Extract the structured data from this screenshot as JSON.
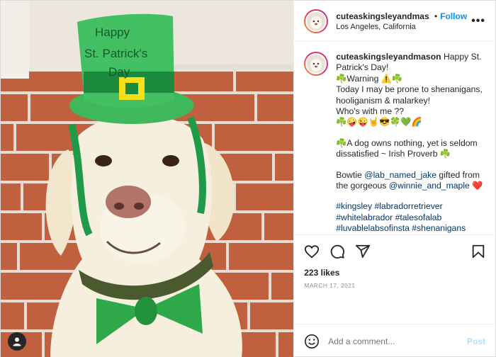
{
  "photo": {
    "hat_text_1": "Happy",
    "hat_text_2": "St. Patrick's",
    "hat_text_3": "Day"
  },
  "header": {
    "username": "cuteaskingsleyandmas ",
    "separator": "•",
    "follow_label": "Follow",
    "location": "Los Angeles, California",
    "more_label": "•••"
  },
  "caption": {
    "username": "cuteaskingsleyandmason",
    "line1": " Happy St. Patrick's Day!",
    "line2": "☘️Warning ⚠️☘️",
    "line3": "Today I may be prone to shenanigans, hooliganism & malarkey!",
    "line4": "Who's with me ??",
    "line5": "☘️🤪😜🤘😎🍀💚🌈",
    "proverb": "☘️A dog owns nothing, yet is seldom dissatisfied ~ Irish Proverb ☘️",
    "bowtie_pre": "Bowtie ",
    "bowtie_mention": "@lab_named_jake",
    "bowtie_mid": " gifted from the gorgeous ",
    "bowtie_mention2": "@winnie_and_maple",
    "bowtie_heart": " ❤️",
    "hashtags": "#kingsley #labradorretriever #whitelabrador #talesofalab #luvablelabsofinsta #shenanigans #malarkey #kissmeimirish☘️ #labsofinstagram #labs_of_insta"
  },
  "stats": {
    "likes": "223 likes",
    "date": "MARCH 17, 2021"
  },
  "comment_box": {
    "placeholder": "Add a comment...",
    "post_label": "Post"
  },
  "icons": [
    "like-icon",
    "comment-icon",
    "share-icon",
    "bookmark-icon",
    "emoji-icon",
    "user-tag-icon"
  ]
}
